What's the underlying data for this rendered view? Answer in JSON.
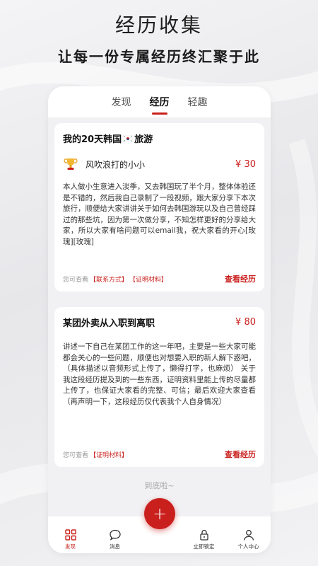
{
  "hero": {
    "title": "经历收集",
    "subtitle": "让每一份专属经历终汇聚于此"
  },
  "tabs": [
    {
      "label": "发现",
      "active": false
    },
    {
      "label": "经历",
      "active": true
    },
    {
      "label": "轻趣",
      "active": false
    }
  ],
  "cards": [
    {
      "title_prefix": "我的20天韩国",
      "title_suffix": "旅游",
      "flag_icon": "south-korea-flag-icon",
      "author": "风吹浪打的小小",
      "price": "¥ 30",
      "body": "本人做小生意进入淡季，又去韩国玩了半个月，整体体验还是不错的，然后我自己录制了一段视频，跟大家分享下本次旅行，顺便给大家讲讲关于如何去韩国游玩以及自己曾经踩过的那些坑，因为第一次做分享，不知怎样更好的分享给大家，所以大家有啥问题可以email我，祝大家看的开心[玫瑰][玫瑰]",
      "footer_hint": "您可查看",
      "tags": [
        "【联系方式】",
        "【证明材料】"
      ],
      "action": "查看经历"
    },
    {
      "title": "某团外卖从入职到离职",
      "price": "¥ 80",
      "body": "讲述一下自己在某团工作的这一年吧，主要是一些大家可能都会关心的一些问题，顺便也对想要入职的新人解下惑吧，（具体描述以音频形式上传了，懒得打字，也麻烦） 关于我这段经历提及到的一些东西，证明资料里能上传的尽量都上传了，也保证大家看的完整、可信；最后欢迎大家查看 （再声明一下，这段经历仅代表我个人自身情况）",
      "footer_hint": "您可查看",
      "tags": [
        "【证明材料】"
      ],
      "action": "查看经历"
    }
  ],
  "end_text": "到底啦~",
  "nav": {
    "items": [
      {
        "label": "发现",
        "icon": "grid-icon",
        "active": true
      },
      {
        "label": "消息",
        "icon": "chat-bubble-icon",
        "active": false
      },
      {
        "label": "立即锁定",
        "icon": "lock-icon",
        "active": false
      },
      {
        "label": "个人中心",
        "icon": "user-icon",
        "active": false
      }
    ],
    "fab_icon": "plus-icon",
    "fab_label": "+"
  },
  "colors": {
    "accent": "#c9201d",
    "background": "#f1f1f3"
  }
}
